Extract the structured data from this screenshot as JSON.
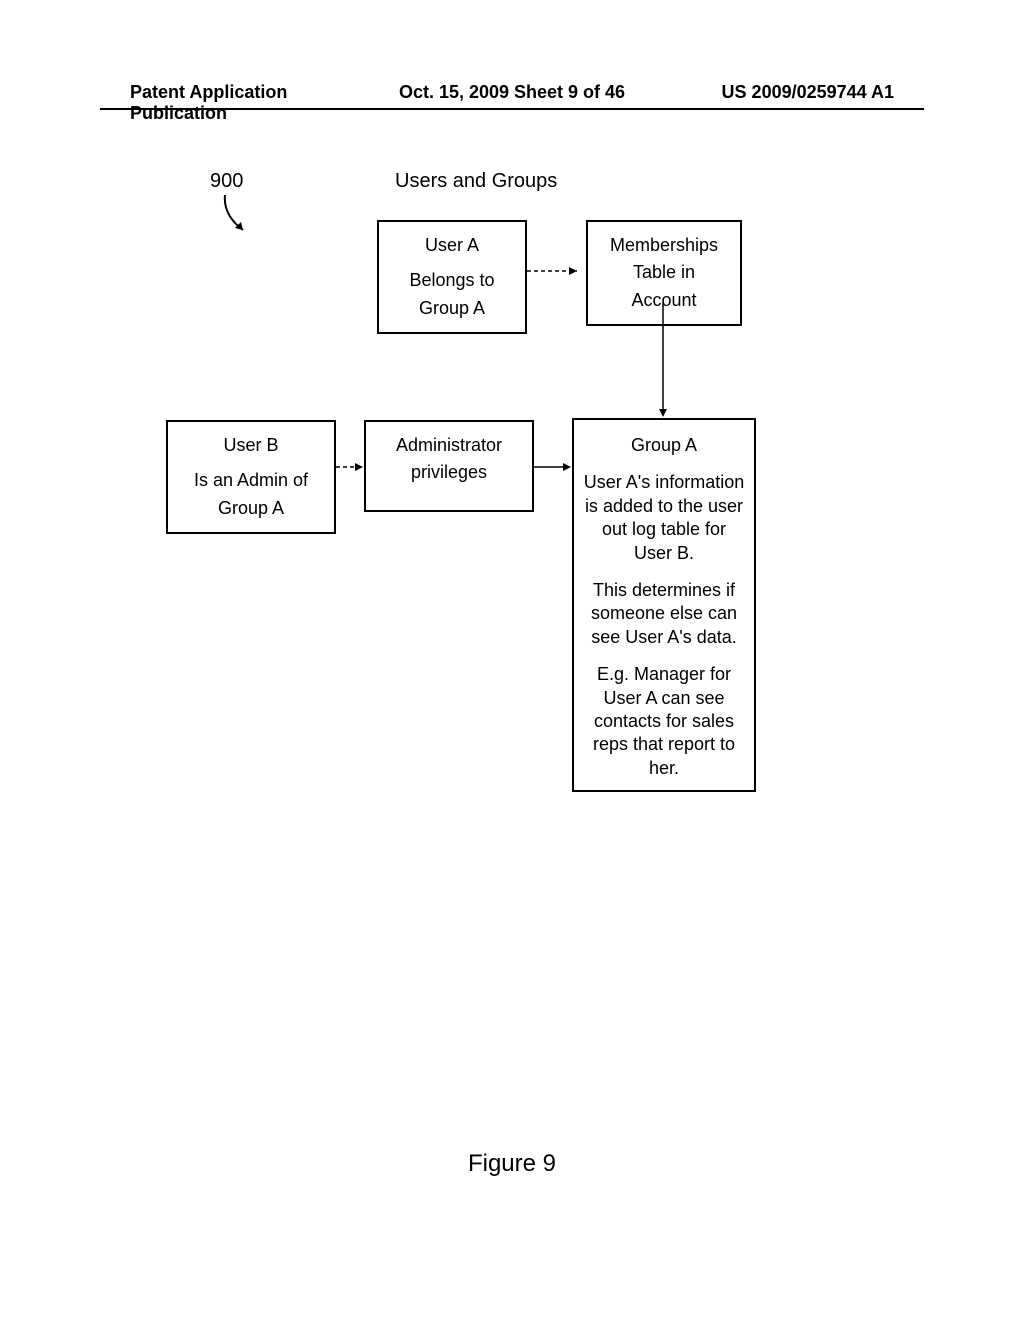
{
  "header": {
    "left": "Patent Application Publication",
    "center": "Oct. 15, 2009  Sheet 9 of 46",
    "right": "US 2009/0259744 A1"
  },
  "diagram": {
    "title": "Users and Groups",
    "ref_number": "900",
    "boxes": {
      "user_a": {
        "line1": "User A",
        "line2": "Belongs to",
        "line3": "Group A"
      },
      "memberships": {
        "line1": "Memberships",
        "line2": "Table in",
        "line3": "Account"
      },
      "user_b": {
        "line1": "User B",
        "line2": "Is an Admin of",
        "line3": "Group A"
      },
      "admin": {
        "line1": "Administrator",
        "line2": "privileges"
      },
      "group_a": {
        "title": "Group A",
        "para1": "User A's information is added to the user out log table for User B.",
        "para2": "This determines if someone else can see User A's data.",
        "para3": "E.g. Manager for User A can see contacts for sales reps that report to her."
      }
    }
  },
  "figure_label": "Figure 9"
}
